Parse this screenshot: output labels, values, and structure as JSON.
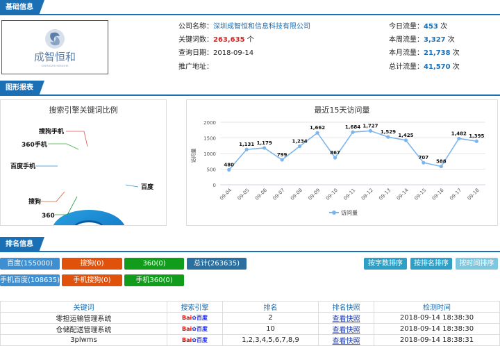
{
  "sections": {
    "basic": "基础信息",
    "charts": "图形报表",
    "ranking": "排名信息"
  },
  "company": {
    "logo_text": "成智恒和",
    "logo_sub": "CHENGZHI HENGHE",
    "name_label": "公司名称：",
    "name": "深圳成智恒和信息科技有限公司",
    "keywords_label": "关键词数：",
    "keywords": "263,635",
    "keywords_unit": "个",
    "date_label": "查询日期：",
    "date": "2018-09-14",
    "promo_label": "推广地址：",
    "promo": ""
  },
  "traffic": [
    {
      "label": "今日流量：",
      "value": "453",
      "unit": "次"
    },
    {
      "label": "本周流量：",
      "value": "3,327",
      "unit": "次"
    },
    {
      "label": "本月流量：",
      "value": "21,738",
      "unit": "次"
    },
    {
      "label": "总计流量：",
      "value": "41,570",
      "unit": "次"
    }
  ],
  "pie_title": "搜索引擎关键词比例",
  "pie_labels": [
    "搜狗手机",
    "360手机",
    "百度手机",
    "搜狗",
    "360",
    "百度"
  ],
  "chart_data": {
    "type": "line",
    "title": "最近15天访问量",
    "ylabel": "访问量",
    "legend": "访问量",
    "categories": [
      "09-04",
      "09-05",
      "09-06",
      "09-07",
      "09-08",
      "09-09",
      "09-10",
      "09-11",
      "09-12",
      "09-13",
      "09-14",
      "09-15",
      "09-16",
      "09-17",
      "09-18"
    ],
    "values": [
      480,
      1131,
      1179,
      799,
      1234,
      1662,
      867,
      1684,
      1727,
      1529,
      1425,
      707,
      588,
      1482,
      1395
    ],
    "ylim": [
      0,
      2000
    ],
    "yticks": [
      0,
      500,
      1000,
      1500,
      2000
    ],
    "color": "#7cb5ec"
  },
  "engine_buttons": [
    {
      "label": "百度(155000)",
      "color": "blue"
    },
    {
      "label": "搜狗(0)",
      "color": "orange"
    },
    {
      "label": "360(0)",
      "color": "green"
    },
    {
      "label": "总计(263635)",
      "color": "steel"
    },
    {
      "label": "手机百度(108635)",
      "color": "blue"
    },
    {
      "label": "手机搜狗(0)",
      "color": "orange"
    },
    {
      "label": "手机360(0)",
      "color": "green"
    }
  ],
  "sort_buttons": [
    "按字数排序",
    "按排名排序",
    "按时间排序"
  ],
  "table": {
    "headers": [
      "关键词",
      "搜索引擎",
      "排名",
      "排名快照",
      "检测时间"
    ],
    "rows": [
      {
        "keyword": "零担运输管理系统",
        "engine": "百度",
        "rank": "2",
        "snapshot": "查看快照",
        "time": "2018-09-14 18:38:30"
      },
      {
        "keyword": "仓储配送管理系统",
        "engine": "百度",
        "rank": "10",
        "snapshot": "查看快照",
        "time": "2018-09-14 18:38:30"
      },
      {
        "keyword": "3plwms",
        "engine": "百度",
        "rank": "1,2,3,4,5,6,7,8,9",
        "snapshot": "查看快照",
        "time": "2018-09-14 18:38:31"
      }
    ]
  }
}
